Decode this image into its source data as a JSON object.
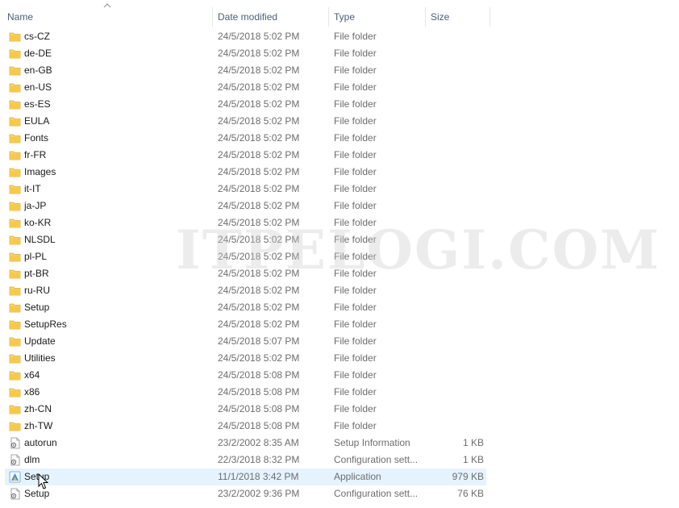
{
  "columns": {
    "name": "Name",
    "date_modified": "Date modified",
    "type": "Type",
    "size": "Size"
  },
  "sort": {
    "column": "Name",
    "direction": "ascending"
  },
  "colors": {
    "selected_row": "#e5f3ff",
    "folder": "#f7c948",
    "header_text": "#4c607a"
  },
  "watermark": "ITPELOGI.COM",
  "files": [
    {
      "name": "cs-CZ",
      "date": "24/5/2018 5:02 PM",
      "type": "File folder",
      "size": "",
      "icon": "folder-icon"
    },
    {
      "name": "de-DE",
      "date": "24/5/2018 5:02 PM",
      "type": "File folder",
      "size": "",
      "icon": "folder-icon"
    },
    {
      "name": "en-GB",
      "date": "24/5/2018 5:02 PM",
      "type": "File folder",
      "size": "",
      "icon": "folder-icon"
    },
    {
      "name": "en-US",
      "date": "24/5/2018 5:02 PM",
      "type": "File folder",
      "size": "",
      "icon": "folder-icon"
    },
    {
      "name": "es-ES",
      "date": "24/5/2018 5:02 PM",
      "type": "File folder",
      "size": "",
      "icon": "folder-icon"
    },
    {
      "name": "EULA",
      "date": "24/5/2018 5:02 PM",
      "type": "File folder",
      "size": "",
      "icon": "folder-icon"
    },
    {
      "name": "Fonts",
      "date": "24/5/2018 5:02 PM",
      "type": "File folder",
      "size": "",
      "icon": "folder-icon"
    },
    {
      "name": "fr-FR",
      "date": "24/5/2018 5:02 PM",
      "type": "File folder",
      "size": "",
      "icon": "folder-icon"
    },
    {
      "name": "Images",
      "date": "24/5/2018 5:02 PM",
      "type": "File folder",
      "size": "",
      "icon": "folder-icon"
    },
    {
      "name": "it-IT",
      "date": "24/5/2018 5:02 PM",
      "type": "File folder",
      "size": "",
      "icon": "folder-icon"
    },
    {
      "name": "ja-JP",
      "date": "24/5/2018 5:02 PM",
      "type": "File folder",
      "size": "",
      "icon": "folder-icon"
    },
    {
      "name": "ko-KR",
      "date": "24/5/2018 5:02 PM",
      "type": "File folder",
      "size": "",
      "icon": "folder-icon"
    },
    {
      "name": "NLSDL",
      "date": "24/5/2018 5:02 PM",
      "type": "File folder",
      "size": "",
      "icon": "folder-icon"
    },
    {
      "name": "pl-PL",
      "date": "24/5/2018 5:02 PM",
      "type": "File folder",
      "size": "",
      "icon": "folder-icon"
    },
    {
      "name": "pt-BR",
      "date": "24/5/2018 5:02 PM",
      "type": "File folder",
      "size": "",
      "icon": "folder-icon"
    },
    {
      "name": "ru-RU",
      "date": "24/5/2018 5:02 PM",
      "type": "File folder",
      "size": "",
      "icon": "folder-icon"
    },
    {
      "name": "Setup",
      "date": "24/5/2018 5:02 PM",
      "type": "File folder",
      "size": "",
      "icon": "folder-icon"
    },
    {
      "name": "SetupRes",
      "date": "24/5/2018 5:02 PM",
      "type": "File folder",
      "size": "",
      "icon": "folder-icon"
    },
    {
      "name": "Update",
      "date": "24/5/2018 5:07 PM",
      "type": "File folder",
      "size": "",
      "icon": "folder-icon"
    },
    {
      "name": "Utilities",
      "date": "24/5/2018 5:02 PM",
      "type": "File folder",
      "size": "",
      "icon": "folder-icon"
    },
    {
      "name": "x64",
      "date": "24/5/2018 5:08 PM",
      "type": "File folder",
      "size": "",
      "icon": "folder-icon"
    },
    {
      "name": "x86",
      "date": "24/5/2018 5:08 PM",
      "type": "File folder",
      "size": "",
      "icon": "folder-icon"
    },
    {
      "name": "zh-CN",
      "date": "24/5/2018 5:08 PM",
      "type": "File folder",
      "size": "",
      "icon": "folder-icon"
    },
    {
      "name": "zh-TW",
      "date": "24/5/2018 5:08 PM",
      "type": "File folder",
      "size": "",
      "icon": "folder-icon"
    },
    {
      "name": "autorun",
      "date": "23/2/2002 8:35 AM",
      "type": "Setup Information",
      "size": "1 KB",
      "icon": "settings-file-icon"
    },
    {
      "name": "dlm",
      "date": "22/3/2018 8:32 PM",
      "type": "Configuration sett...",
      "size": "1 KB",
      "icon": "settings-file-icon"
    },
    {
      "name": "Setup",
      "date": "11/1/2018 3:42 PM",
      "type": "Application",
      "size": "979 KB",
      "icon": "application-icon",
      "selected": true
    },
    {
      "name": "Setup",
      "date": "23/2/2002 9:36 PM",
      "type": "Configuration sett...",
      "size": "76 KB",
      "icon": "settings-file-icon"
    }
  ]
}
